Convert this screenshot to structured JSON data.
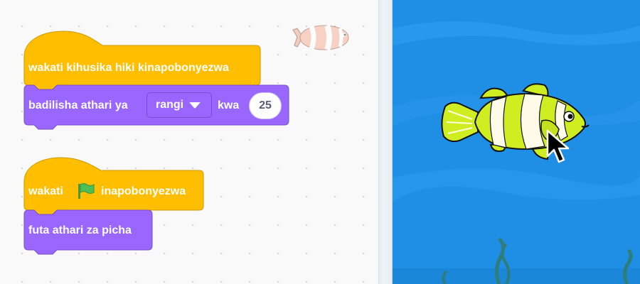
{
  "code_area": {
    "script1": {
      "hat_label": "wakati kihusika hiki kinapobonyezwa",
      "effect_block": {
        "label_before": "badilisha athari ya",
        "dropdown_value": "rangi",
        "label_after": "kwa",
        "value": "25"
      }
    },
    "script2": {
      "hat_label_before": "wakati",
      "hat_label_after": "inapobonyezwa",
      "clear_block_label": "futa athari za picha"
    },
    "sprite_thumbnail_icon": "clownfish-sprite-icon",
    "flag_icon": "green-flag-icon"
  },
  "stage": {
    "backdrop": "underwater",
    "sprite": "clownfish",
    "color_effect": "yellow-green tint",
    "cursor_icon": "mouse-pointer-icon"
  },
  "colors": {
    "events": "#ffbf00",
    "events_border": "#cc9900",
    "looks": "#9966ff",
    "looks_border": "#774dcb",
    "stage_water": "#1f8fe6"
  }
}
